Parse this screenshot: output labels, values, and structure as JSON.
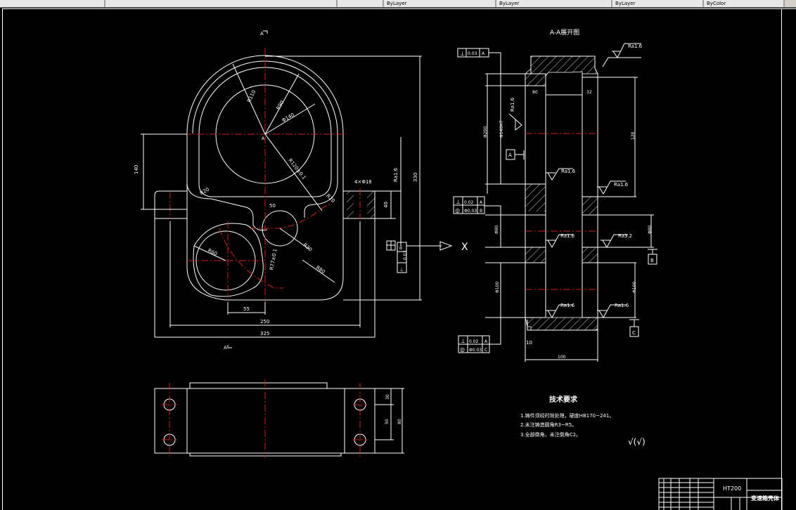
{
  "toolbar": {
    "segments": [
      "",
      "",
      "",
      "ByLayer",
      "ByLayer",
      "ByLayer",
      "ByColor"
    ]
  },
  "drawing": {
    "section_marks": {
      "top": "A",
      "bottom": "A"
    },
    "main_view": {
      "center_label": "A",
      "dims": {
        "height_left": "140",
        "height_total": "330",
        "width_inner": "250",
        "width_total": "325",
        "offset_bottom": "55",
        "offset_small": "50",
        "hole_note": "4×Φ18",
        "flange_h": "40",
        "roughness": "Ra1.6",
        "r_outer": "R110",
        "r_mid": "R90",
        "dia_bore": "Φ140",
        "r_slot": "R120±0.1",
        "r_small": "R60",
        "r_corner_l": "R20",
        "r_corner_r": "R20",
        "r_hole": "R30",
        "r_arc": "R80",
        "r_link": "R77±0.1"
      },
      "datum_box": {
        "symbol": "⊥",
        "tol": "0.03",
        "ref": "B"
      }
    },
    "section_view": {
      "title": "A-A展开图",
      "tol_top": {
        "symbol": "⊥",
        "tol": "0.03",
        "ref": "A"
      },
      "tol_mid": [
        {
          "symbol": "⊥",
          "tol": "0.02",
          "ref": "A"
        },
        {
          "symbol": "◎",
          "tol": "Φ0.03",
          "ref": "B"
        }
      ],
      "tol_bot": [
        {
          "symbol": "⊥",
          "tol": "0.02",
          "ref": "A"
        },
        {
          "symbol": "◎",
          "tol": "Φ0.03",
          "ref": "C"
        }
      ],
      "datums": {
        "a": "A",
        "b": "B",
        "c": "C"
      },
      "dims": {
        "d1": "80",
        "d2": "32",
        "d3": "Φ140",
        "d4": "120",
        "d5": "10",
        "d6": "100",
        "left_dia": "Φ200",
        "fit": "Φ140H7",
        "d_mid": "Φ80",
        "d_low": "Φ100",
        "d_right_mid": "Φ80",
        "d_right_low": "Φ100"
      },
      "roughness": [
        "Ra1.6",
        "Ra1.6",
        "Ra1.6",
        "Ra1.6",
        "Ra1.6",
        "Ra1.6",
        "Ra1.6",
        "Ra3.2"
      ],
      "cut_mark": "X"
    },
    "bottom_view": {
      "dims": {
        "a": "30",
        "b": "50",
        "c": "80"
      }
    },
    "tech_requirements": {
      "title": "技术要求",
      "items": [
        "1.铸件须经时效处理，硬度HB170~241。",
        "2.未注铸造圆角R3~R5。",
        "3.全部倒角，未注倒角C2。"
      ],
      "roughness_note": "√(√)"
    },
    "title_block": {
      "material": "HT200",
      "part_name": "变速箱壳体"
    }
  }
}
